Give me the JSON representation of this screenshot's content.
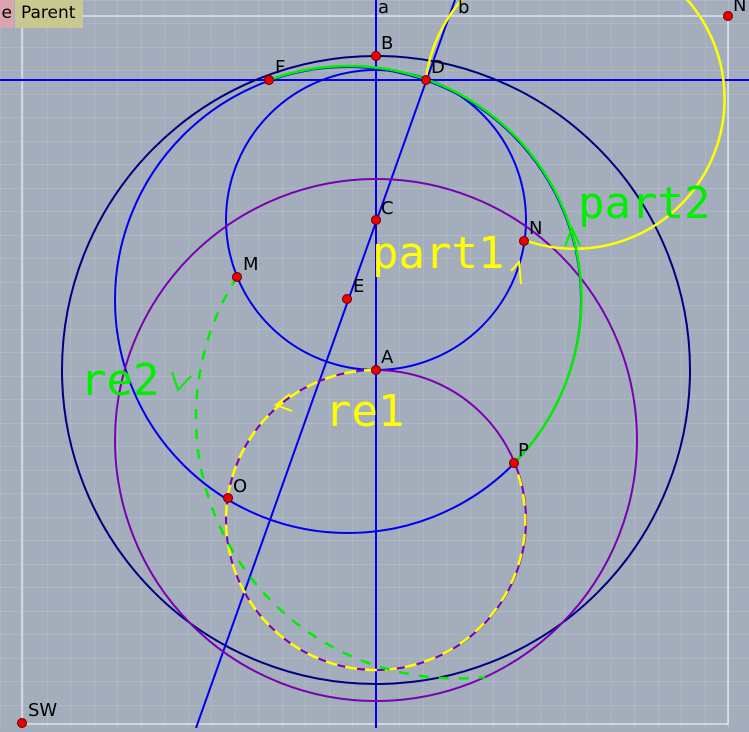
{
  "toolbar": {
    "partial_label": "e",
    "parent_label": "Parent"
  },
  "corner_labels": {
    "ne": "N",
    "sw": "SW"
  },
  "lines": {
    "a": "a",
    "b": "b"
  },
  "points": {
    "B": "B",
    "F": "F",
    "D": "D",
    "C": "C",
    "N": "N",
    "M": "M",
    "E": "E",
    "A": "A",
    "P": "P",
    "O": "O"
  },
  "arc_labels": {
    "part1": "part1",
    "part2": "part2",
    "re1": "re1",
    "re2": "re2"
  },
  "colors": {
    "background": "#a4adbb",
    "grid": "#b8c0cc",
    "frame": "#ffffff",
    "axis_blue": "#0000ee",
    "outer_circle": "#000080",
    "purple_circle": "#7a00b0",
    "yellow": "#ffff00",
    "green": "#00ee00",
    "point_fill": "#ee0000"
  }
}
